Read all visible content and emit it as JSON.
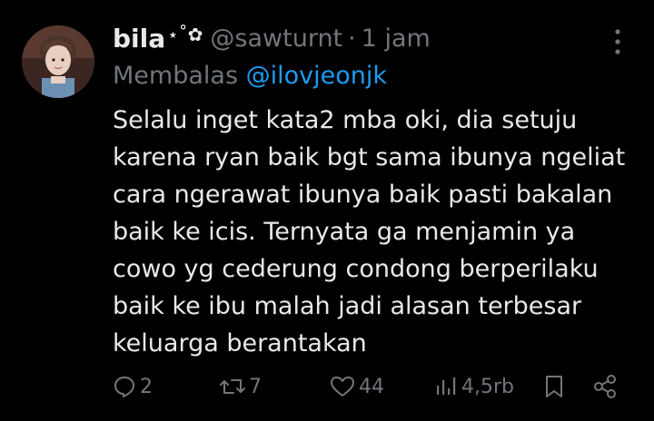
{
  "tweet": {
    "display_name": "bila",
    "name_decoration": "⋆˚✿",
    "handle": "@sawturnt",
    "separator": "·",
    "time": "1 jam",
    "replying_prefix": "Membalas ",
    "replying_to": "@ilovjeonjk",
    "text": "Selalu inget kata2 mba oki, dia setuju\nkarena ryan baik bgt sama ibunya ngeliat\ncara ngerawat ibunya baik pasti bakalan\nbaik ke icis. Ternyata ga menjamin ya\ncowo yg cederung condong berperilaku\nbaik ke ibu malah jadi alasan terbesar\nkeluarga berantakan"
  },
  "actions": {
    "reply_count": "2",
    "retweet_count": "7",
    "like_count": "44",
    "view_count": "4,5rb"
  },
  "icons": {
    "reply": "speech-bubble-icon",
    "retweet": "retweet-icon",
    "like": "heart-icon",
    "views": "bar-chart-icon",
    "bookmark": "bookmark-icon",
    "share": "share-icon",
    "more": "more-vertical-icon"
  },
  "colors": {
    "background": "#000000",
    "text_primary": "#e7e9ea",
    "text_secondary": "#71767b",
    "link": "#1d9bf0"
  }
}
